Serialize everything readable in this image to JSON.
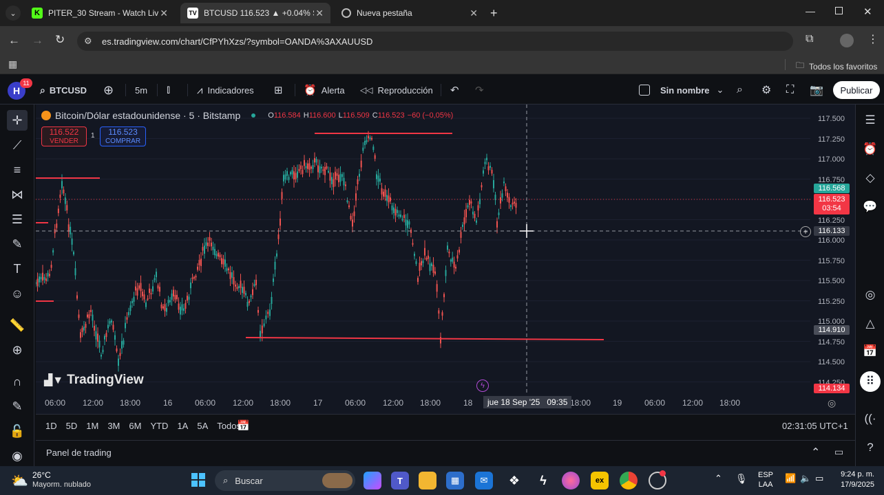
{
  "browser": {
    "tabs": [
      {
        "title": "PITER_30 Stream - Watch Live c",
        "icon": "k-icon"
      },
      {
        "title": "BTCUSD 116.523 ▲ +0.04% Sin",
        "icon": "tradingview-icon"
      },
      {
        "title": "Nueva pestaña",
        "icon": "chrome-icon"
      }
    ],
    "url": "es.tradingview.com/chart/CfPYhXzs/?symbol=OANDA%3AXAUUSD",
    "bookmarks_label": "Todos los favoritos"
  },
  "toolbar": {
    "avatar_letter": "H",
    "notifications": "11",
    "symbol": "BTCUSD",
    "interval": "5m",
    "indicators": "Indicadores",
    "alert": "Alerta",
    "replay": "Reproducción",
    "layout_name": "Sin nombre",
    "publish": "Publicar"
  },
  "chart": {
    "title": "Bitcoin/Dólar estadounidense · 5 · Bitstamp",
    "ohlc": {
      "o_label": "O",
      "o": "116.584",
      "h_label": "H",
      "h": "116.600",
      "l_label": "L",
      "l": "116.509",
      "c_label": "C",
      "c": "116.523",
      "change": "−60 (−0,05%)"
    },
    "sell_price": "116.522",
    "sell_label": "VENDER",
    "spread": "1",
    "buy_price": "116.523",
    "buy_label": "COMPRAR",
    "watermark": "TradingView",
    "price_axis": [
      "117.500",
      "117.250",
      "117.000",
      "116.750",
      "116.500",
      "116.250",
      "116.000",
      "115.750",
      "115.500",
      "115.250",
      "115.000",
      "114.750",
      "114.500",
      "114.250"
    ],
    "price_tags": {
      "high_tag": "116.568",
      "last_price": "116.523",
      "countdown": "03:54",
      "crosshair": "116.133",
      "level_low": "114.910",
      "bottom": "114.134"
    },
    "time_axis": [
      "06:00",
      "12:00",
      "18:00",
      "16",
      "06:00",
      "12:00",
      "18:00",
      "17",
      "06:00",
      "12:00",
      "18:00",
      "18",
      "18:00",
      "19",
      "06:00",
      "12:00",
      "18:00"
    ],
    "crosshair_time": "jue 18 Sep '25",
    "crosshair_clock": "09:35",
    "colors": {
      "up": "#26a69a",
      "down": "#ef5350",
      "line": "#f23645",
      "bg": "#131722"
    }
  },
  "ranges": [
    "1D",
    "5D",
    "1M",
    "3M",
    "6M",
    "YTD",
    "1A",
    "5A",
    "Todos"
  ],
  "clock_utc": "02:31:05 UTC+1",
  "trading_panel": "Panel de trading",
  "taskbar": {
    "weather_temp": "26°C",
    "weather_desc": "Mayorm. nublado",
    "search": "Buscar",
    "lang": "ESP",
    "lang2": "LAA",
    "time": "9:24 p. m.",
    "date": "17/9/2025"
  }
}
